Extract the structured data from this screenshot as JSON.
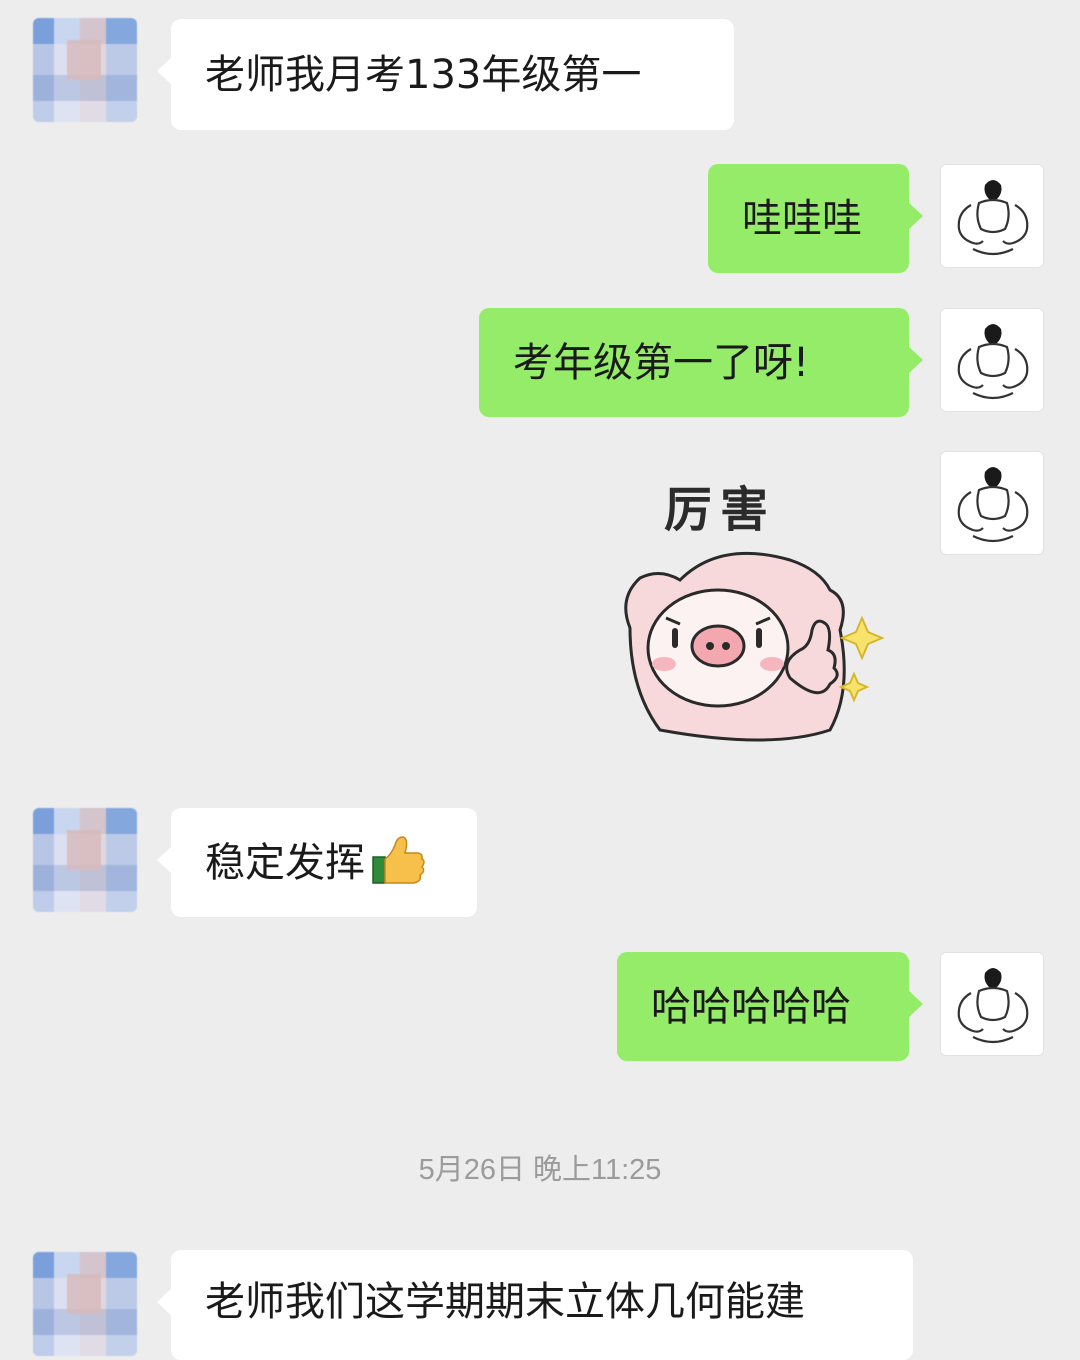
{
  "messages": [
    {
      "from": "peer",
      "text": "老师我月考133年级第一"
    },
    {
      "from": "me",
      "text": "哇哇哇"
    },
    {
      "from": "me",
      "text": "考年级第一了呀!"
    },
    {
      "from": "me",
      "type": "sticker",
      "sticker": {
        "caption": "厉害",
        "icon": "pig-thumbs-up-sticker"
      }
    },
    {
      "from": "peer",
      "text": "稳定发挥",
      "emoji": "thumbs-up-icon"
    },
    {
      "from": "me",
      "text": "哈哈哈哈哈"
    },
    {
      "from": "peer",
      "text": "老师我们这学期期末立体几何能建"
    }
  ],
  "timestamp": "5月26日 晚上11:25",
  "colors": {
    "background": "#ededed",
    "incoming_bubble": "#ffffff",
    "outgoing_bubble": "#95ec69",
    "timestamp_text": "#9b9b9b"
  },
  "icons": {
    "peer_avatar": "pixelated-avatar",
    "my_avatar": "muscle-man-avatar"
  }
}
